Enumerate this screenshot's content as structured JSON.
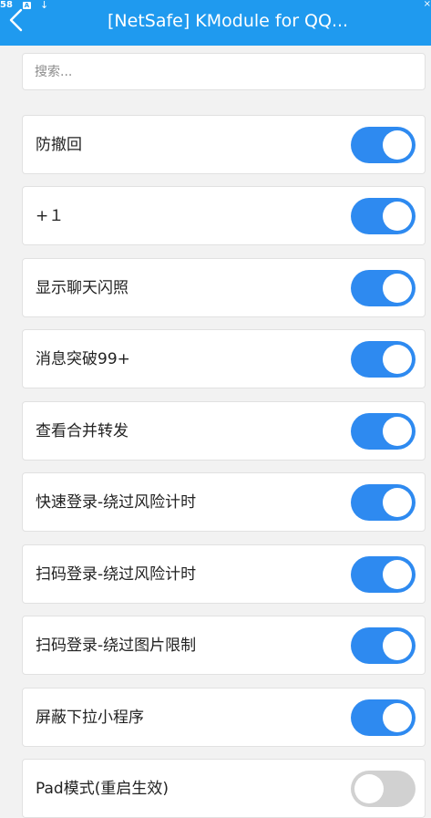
{
  "status_bar": {
    "time": "58",
    "a_icon": "A",
    "download_icon": "↓",
    "close_icon": "×"
  },
  "header": {
    "title": "[NetSafe] KModule for QQ...",
    "back_icon": "chevron-left-icon",
    "background_color": "#1f9aef"
  },
  "search": {
    "placeholder": "搜索...",
    "value": ""
  },
  "settings": [
    {
      "label": "防撤回",
      "enabled": true
    },
    {
      "label": "+１",
      "enabled": true
    },
    {
      "label": "显示聊天闪照",
      "enabled": true
    },
    {
      "label": "消息突破99+",
      "enabled": true
    },
    {
      "label": "查看合并转发",
      "enabled": true
    },
    {
      "label": "快速登录-绕过风险计时",
      "enabled": true
    },
    {
      "label": "扫码登录-绕过风险计时",
      "enabled": true
    },
    {
      "label": "扫码登录-绕过图片限制",
      "enabled": true
    },
    {
      "label": "屏蔽下拉小程序",
      "enabled": true
    },
    {
      "label": "Pad模式(重启生效)",
      "enabled": false
    }
  ],
  "colors": {
    "toggle_on": "#2e8af0",
    "toggle_off": "#d1d1d1",
    "page_background": "#f2f2f2"
  }
}
